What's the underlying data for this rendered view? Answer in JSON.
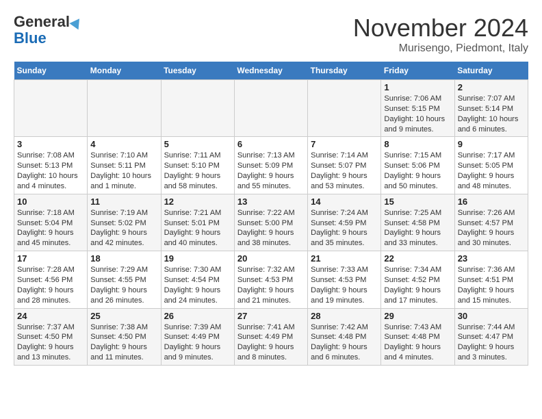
{
  "logo": {
    "line1": "General",
    "line2": "Blue"
  },
  "title": "November 2024",
  "location": "Murisengo, Piedmont, Italy",
  "headers": [
    "Sunday",
    "Monday",
    "Tuesday",
    "Wednesday",
    "Thursday",
    "Friday",
    "Saturday"
  ],
  "weeks": [
    [
      {
        "day": "",
        "info": ""
      },
      {
        "day": "",
        "info": ""
      },
      {
        "day": "",
        "info": ""
      },
      {
        "day": "",
        "info": ""
      },
      {
        "day": "",
        "info": ""
      },
      {
        "day": "1",
        "info": "Sunrise: 7:06 AM\nSunset: 5:15 PM\nDaylight: 10 hours and 9 minutes."
      },
      {
        "day": "2",
        "info": "Sunrise: 7:07 AM\nSunset: 5:14 PM\nDaylight: 10 hours and 6 minutes."
      }
    ],
    [
      {
        "day": "3",
        "info": "Sunrise: 7:08 AM\nSunset: 5:13 PM\nDaylight: 10 hours and 4 minutes."
      },
      {
        "day": "4",
        "info": "Sunrise: 7:10 AM\nSunset: 5:11 PM\nDaylight: 10 hours and 1 minute."
      },
      {
        "day": "5",
        "info": "Sunrise: 7:11 AM\nSunset: 5:10 PM\nDaylight: 9 hours and 58 minutes."
      },
      {
        "day": "6",
        "info": "Sunrise: 7:13 AM\nSunset: 5:09 PM\nDaylight: 9 hours and 55 minutes."
      },
      {
        "day": "7",
        "info": "Sunrise: 7:14 AM\nSunset: 5:07 PM\nDaylight: 9 hours and 53 minutes."
      },
      {
        "day": "8",
        "info": "Sunrise: 7:15 AM\nSunset: 5:06 PM\nDaylight: 9 hours and 50 minutes."
      },
      {
        "day": "9",
        "info": "Sunrise: 7:17 AM\nSunset: 5:05 PM\nDaylight: 9 hours and 48 minutes."
      }
    ],
    [
      {
        "day": "10",
        "info": "Sunrise: 7:18 AM\nSunset: 5:04 PM\nDaylight: 9 hours and 45 minutes."
      },
      {
        "day": "11",
        "info": "Sunrise: 7:19 AM\nSunset: 5:02 PM\nDaylight: 9 hours and 42 minutes."
      },
      {
        "day": "12",
        "info": "Sunrise: 7:21 AM\nSunset: 5:01 PM\nDaylight: 9 hours and 40 minutes."
      },
      {
        "day": "13",
        "info": "Sunrise: 7:22 AM\nSunset: 5:00 PM\nDaylight: 9 hours and 38 minutes."
      },
      {
        "day": "14",
        "info": "Sunrise: 7:24 AM\nSunset: 4:59 PM\nDaylight: 9 hours and 35 minutes."
      },
      {
        "day": "15",
        "info": "Sunrise: 7:25 AM\nSunset: 4:58 PM\nDaylight: 9 hours and 33 minutes."
      },
      {
        "day": "16",
        "info": "Sunrise: 7:26 AM\nSunset: 4:57 PM\nDaylight: 9 hours and 30 minutes."
      }
    ],
    [
      {
        "day": "17",
        "info": "Sunrise: 7:28 AM\nSunset: 4:56 PM\nDaylight: 9 hours and 28 minutes."
      },
      {
        "day": "18",
        "info": "Sunrise: 7:29 AM\nSunset: 4:55 PM\nDaylight: 9 hours and 26 minutes."
      },
      {
        "day": "19",
        "info": "Sunrise: 7:30 AM\nSunset: 4:54 PM\nDaylight: 9 hours and 24 minutes."
      },
      {
        "day": "20",
        "info": "Sunrise: 7:32 AM\nSunset: 4:53 PM\nDaylight: 9 hours and 21 minutes."
      },
      {
        "day": "21",
        "info": "Sunrise: 7:33 AM\nSunset: 4:53 PM\nDaylight: 9 hours and 19 minutes."
      },
      {
        "day": "22",
        "info": "Sunrise: 7:34 AM\nSunset: 4:52 PM\nDaylight: 9 hours and 17 minutes."
      },
      {
        "day": "23",
        "info": "Sunrise: 7:36 AM\nSunset: 4:51 PM\nDaylight: 9 hours and 15 minutes."
      }
    ],
    [
      {
        "day": "24",
        "info": "Sunrise: 7:37 AM\nSunset: 4:50 PM\nDaylight: 9 hours and 13 minutes."
      },
      {
        "day": "25",
        "info": "Sunrise: 7:38 AM\nSunset: 4:50 PM\nDaylight: 9 hours and 11 minutes."
      },
      {
        "day": "26",
        "info": "Sunrise: 7:39 AM\nSunset: 4:49 PM\nDaylight: 9 hours and 9 minutes."
      },
      {
        "day": "27",
        "info": "Sunrise: 7:41 AM\nSunset: 4:49 PM\nDaylight: 9 hours and 8 minutes."
      },
      {
        "day": "28",
        "info": "Sunrise: 7:42 AM\nSunset: 4:48 PM\nDaylight: 9 hours and 6 minutes."
      },
      {
        "day": "29",
        "info": "Sunrise: 7:43 AM\nSunset: 4:48 PM\nDaylight: 9 hours and 4 minutes."
      },
      {
        "day": "30",
        "info": "Sunrise: 7:44 AM\nSunset: 4:47 PM\nDaylight: 9 hours and 3 minutes."
      }
    ]
  ]
}
